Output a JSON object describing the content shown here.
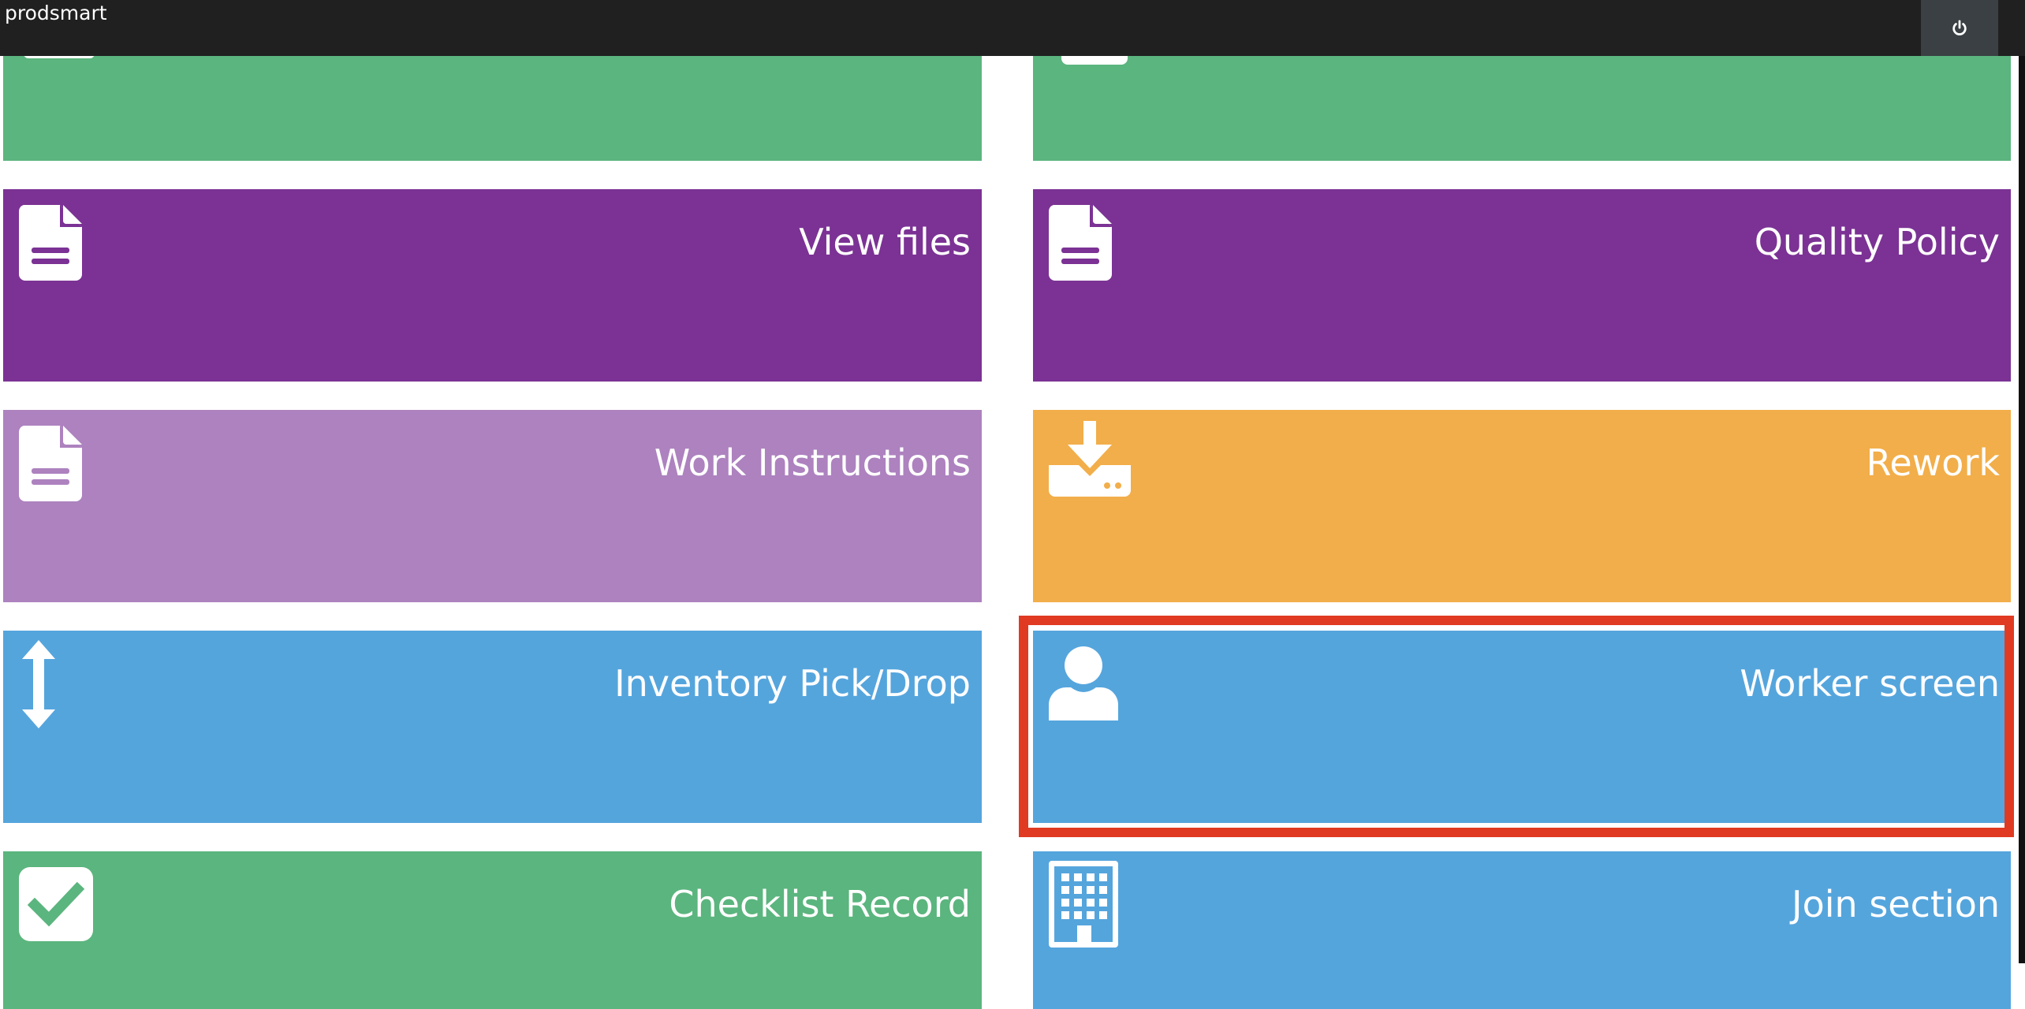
{
  "app": {
    "brand": "prodsmart",
    "power_icon": "power-icon"
  },
  "colors": {
    "green": "#5bb57e",
    "purple": "#7b3294",
    "light_purple": "#ad82bf",
    "orange": "#f2ae4a",
    "blue": "#55a5dd",
    "highlight": "#e03a22"
  },
  "tiles": [
    {
      "label": "",
      "icon": "top-tile-icon",
      "color": "green"
    },
    {
      "label": "",
      "icon": "top-tile-icon",
      "color": "green"
    },
    {
      "label": "View files",
      "icon": "file-icon",
      "color": "purple"
    },
    {
      "label": "Quality Policy",
      "icon": "file-icon",
      "color": "purple"
    },
    {
      "label": "Work Instructions",
      "icon": "file-icon",
      "color": "light_purple"
    },
    {
      "label": "Rework",
      "icon": "download-icon",
      "color": "orange"
    },
    {
      "label": "Inventory Pick/Drop",
      "icon": "vertical-arrows-icon",
      "color": "blue"
    },
    {
      "label": "Worker screen",
      "icon": "user-icon",
      "color": "blue"
    },
    {
      "label": "Checklist Record",
      "icon": "checkbox-icon",
      "color": "green"
    },
    {
      "label": "Join section",
      "icon": "building-icon",
      "color": "blue"
    }
  ]
}
